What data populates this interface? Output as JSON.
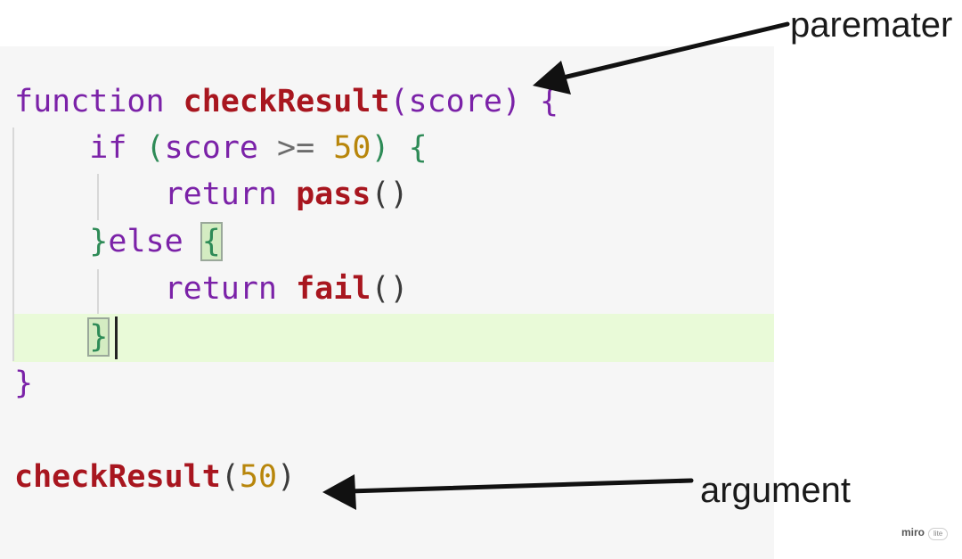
{
  "code": {
    "lines": [
      {
        "keyword": "function",
        "name": "checkResult",
        "open_paren": "(",
        "param": "score",
        "close_paren": ")",
        "brace": "{"
      },
      {
        "keyword": "if",
        "open_paren": "(",
        "var": "score",
        "op": ">=",
        "num": "50",
        "close_paren": ")",
        "brace": "{"
      },
      {
        "keyword": "return",
        "name": "pass",
        "parens": "()"
      },
      {
        "close_brace": "}",
        "keyword": "else",
        "brace": "{"
      },
      {
        "keyword": "return",
        "name": "fail",
        "parens": "()"
      },
      {
        "close_brace": "}"
      },
      {
        "close_brace": "}"
      }
    ],
    "call": {
      "name": "checkResult",
      "open_paren": "(",
      "arg": "50",
      "close_paren": ")"
    },
    "highlighted_line": 6
  },
  "annotations": {
    "parameter_label": "paremater",
    "argument_label": "argument"
  },
  "badge": {
    "brand": "miro",
    "tag": "lite"
  },
  "colors": {
    "keyword": "#7b22a8",
    "function_name": "#a8161f",
    "number": "#b8860b",
    "current_line": "#e9fad8"
  }
}
